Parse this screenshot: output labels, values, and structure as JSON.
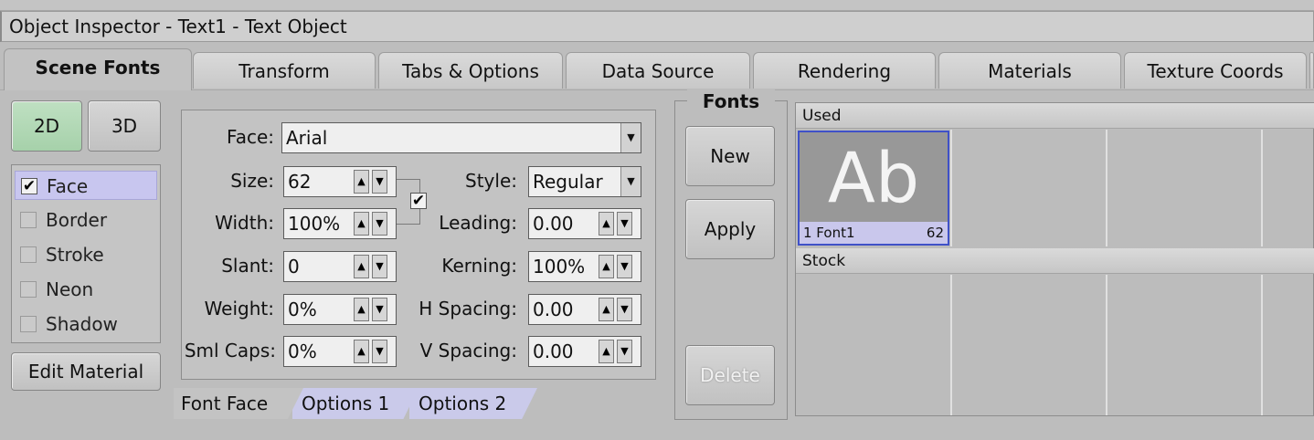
{
  "window": {
    "title": "Object Inspector - Text1 - Text Object"
  },
  "tabs": [
    {
      "label": "Scene Fonts",
      "active": true
    },
    {
      "label": "Transform"
    },
    {
      "label": "Tabs & Options"
    },
    {
      "label": "Data Source"
    },
    {
      "label": "Rendering"
    },
    {
      "label": "Materials"
    },
    {
      "label": "Texture Coords"
    }
  ],
  "dimension": {
    "btn_2d": "2D",
    "btn_3d": "3D"
  },
  "layers": [
    {
      "label": "Face",
      "checked": true,
      "check_mark": "✔"
    },
    {
      "label": "Border"
    },
    {
      "label": "Stroke"
    },
    {
      "label": "Neon"
    },
    {
      "label": "Shadow"
    }
  ],
  "edit_material_label": "Edit Material",
  "face": {
    "face_label": "Face:",
    "face_value": "Arial",
    "size_label": "Size:",
    "size_value": "62",
    "width_label": "Width:",
    "width_value": "100%",
    "slant_label": "Slant:",
    "slant_value": "0",
    "weight_label": "Weight:",
    "weight_value": "0%",
    "smlcaps_label": "Sml Caps:",
    "smlcaps_value": "0%",
    "style_label": "Style:",
    "style_value": "Regular",
    "leading_label": "Leading:",
    "leading_value": "0.00",
    "kerning_label": "Kerning:",
    "kerning_value": "100%",
    "hspacing_label": "H Spacing:",
    "hspacing_value": "0.00",
    "vspacing_label": "V Spacing:",
    "vspacing_value": "0.00",
    "lock_check": "✔"
  },
  "subtabs": [
    {
      "label": "Font Face",
      "active": true
    },
    {
      "label": "Options 1"
    },
    {
      "label": "Options 2"
    }
  ],
  "fonts_group": {
    "title": "Fonts",
    "new_label": "New",
    "apply_label": "Apply",
    "delete_label": "Delete"
  },
  "browser": {
    "used_label": "Used",
    "stock_label": "Stock",
    "used_fonts": [
      {
        "preview": "Ab",
        "name": "1 Font1",
        "size": "62"
      }
    ]
  },
  "glyphs": {
    "up": "▲",
    "down": "▼"
  }
}
